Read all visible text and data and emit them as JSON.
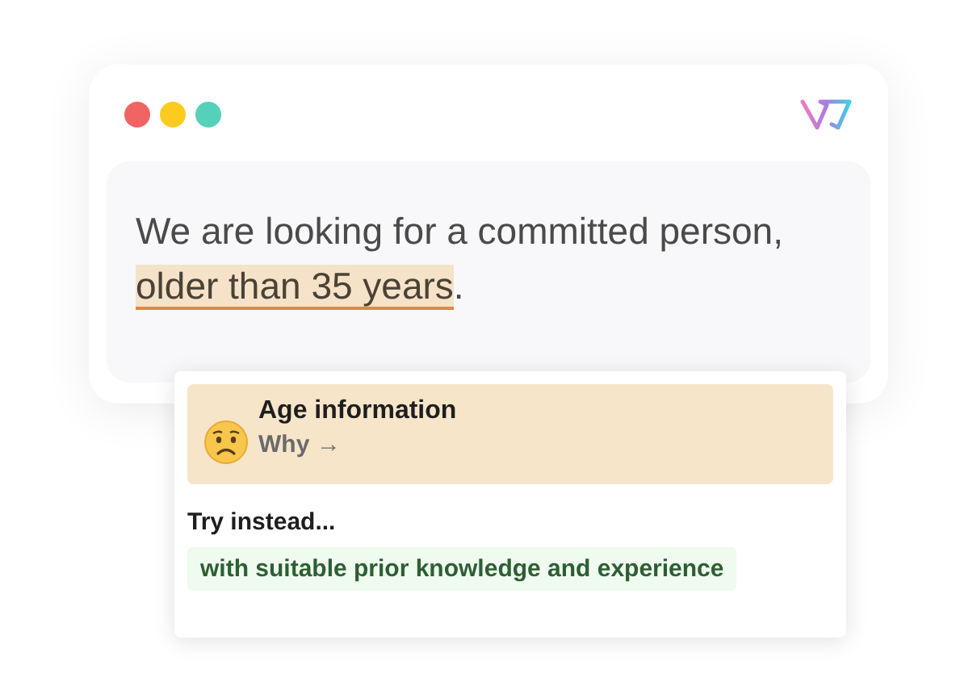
{
  "window": {
    "dots": [
      {
        "color": "#f06464"
      },
      {
        "color": "#fdcb1f"
      },
      {
        "color": "#55d0b9"
      }
    ]
  },
  "editor": {
    "text_before": "We are looking for a committed person, ",
    "flagged": "older than 35 years",
    "text_after": "."
  },
  "popup": {
    "title": "Age information",
    "link": "Why",
    "link_arrow": "→",
    "try_label": "Try instead...",
    "suggestions": [
      "with suitable prior knowledge and experience"
    ]
  }
}
